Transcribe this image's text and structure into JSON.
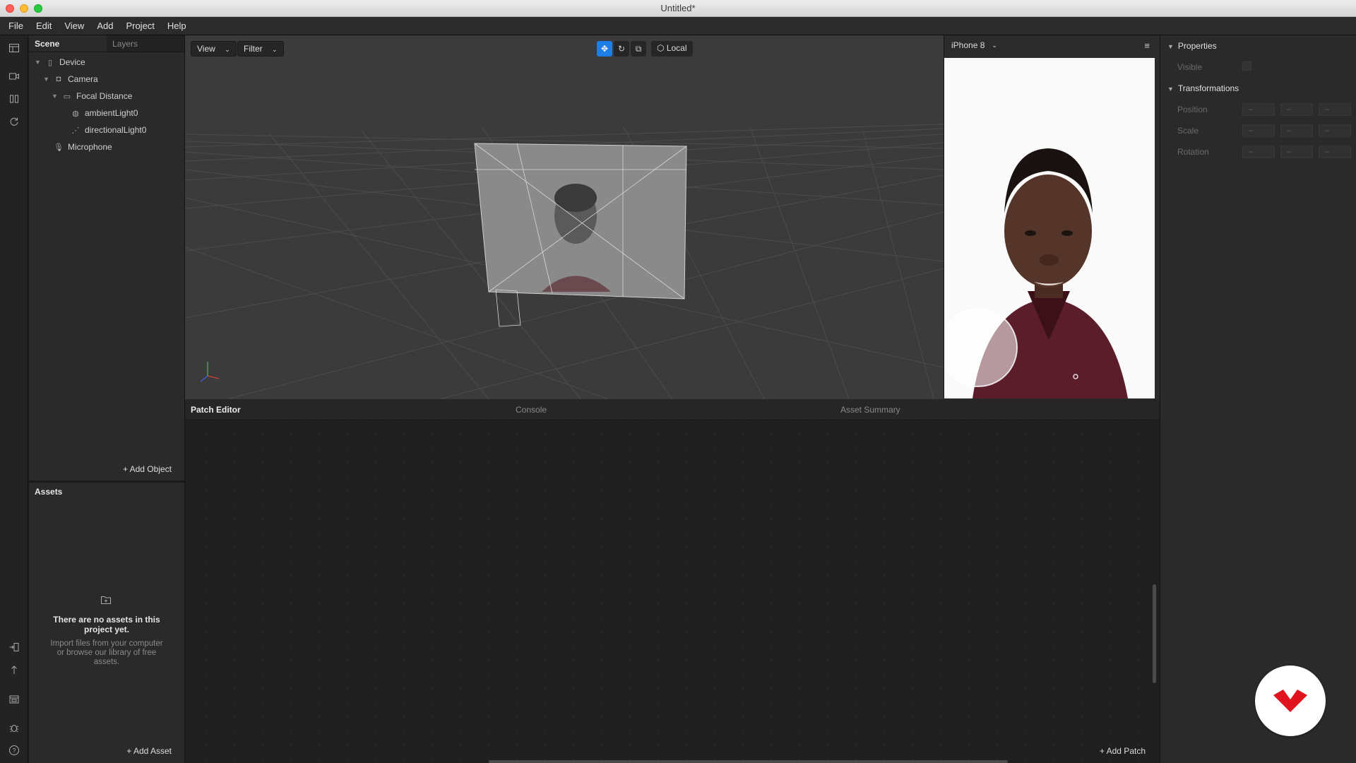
{
  "window": {
    "title": "Untitled*"
  },
  "menubar": {
    "items": [
      "File",
      "Edit",
      "View",
      "Add",
      "Project",
      "Help"
    ]
  },
  "scene": {
    "tabs": [
      "Scene",
      "Layers"
    ],
    "tree": [
      {
        "label": "Device",
        "icon": "device-icon"
      },
      {
        "label": "Camera",
        "icon": "camera-icon"
      },
      {
        "label": "Focal Distance",
        "icon": "focal-distance-icon"
      },
      {
        "label": "ambientLight0",
        "icon": "ambient-light-icon"
      },
      {
        "label": "directionalLight0",
        "icon": "directional-light-icon"
      },
      {
        "label": "Microphone",
        "icon": "microphone-icon"
      }
    ],
    "add_object": "Add Object"
  },
  "assets": {
    "title": "Assets",
    "empty_heading": "There are no assets in this project yet.",
    "empty_sub": "Import files from your computer or browse our library of free assets.",
    "add_asset": "Add Asset"
  },
  "viewport": {
    "view_label": "View",
    "filter_label": "Filter",
    "space_label": "Local"
  },
  "preview": {
    "device": "iPhone 8"
  },
  "bottom": {
    "tabs": [
      "Patch Editor",
      "Console",
      "Asset Summary"
    ],
    "add_patch": "Add Patch"
  },
  "properties": {
    "properties_title": "Properties",
    "visible_label": "Visible",
    "transformations_title": "Transformations",
    "rows": [
      "Position",
      "Scale",
      "Rotation"
    ],
    "field_placeholder": "–"
  },
  "colors": {
    "accent": "#1e7ee8",
    "brand": "#e0141e"
  }
}
